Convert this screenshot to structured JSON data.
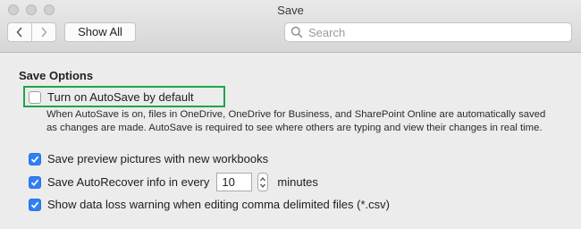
{
  "window": {
    "title": "Save"
  },
  "toolbar": {
    "back_icon": "chevron-left-icon",
    "forward_icon": "chevron-right-icon",
    "show_all_label": "Show All",
    "search_placeholder": "Search",
    "search_value": ""
  },
  "save_options": {
    "heading": "Save Options",
    "autosave": {
      "label": "Turn on AutoSave by default",
      "checked": false,
      "description": "When AutoSave is on, files in OneDrive, OneDrive for Business, and SharePoint Online are automatically saved as changes are made. AutoSave is required to see where others are typing and view their changes in real time."
    },
    "preview_pictures": {
      "label": "Save preview pictures with new workbooks",
      "checked": true
    },
    "autorecover": {
      "label": "Save AutoRecover info in every",
      "checked": true,
      "value": "10",
      "unit": "minutes"
    },
    "data_loss_warning": {
      "label": "Show data loss warning when editing comma delimited files (*.csv)",
      "checked": true
    }
  },
  "colors": {
    "highlight": "#1ea54a",
    "checkbox_on": "#2f7ff6"
  }
}
